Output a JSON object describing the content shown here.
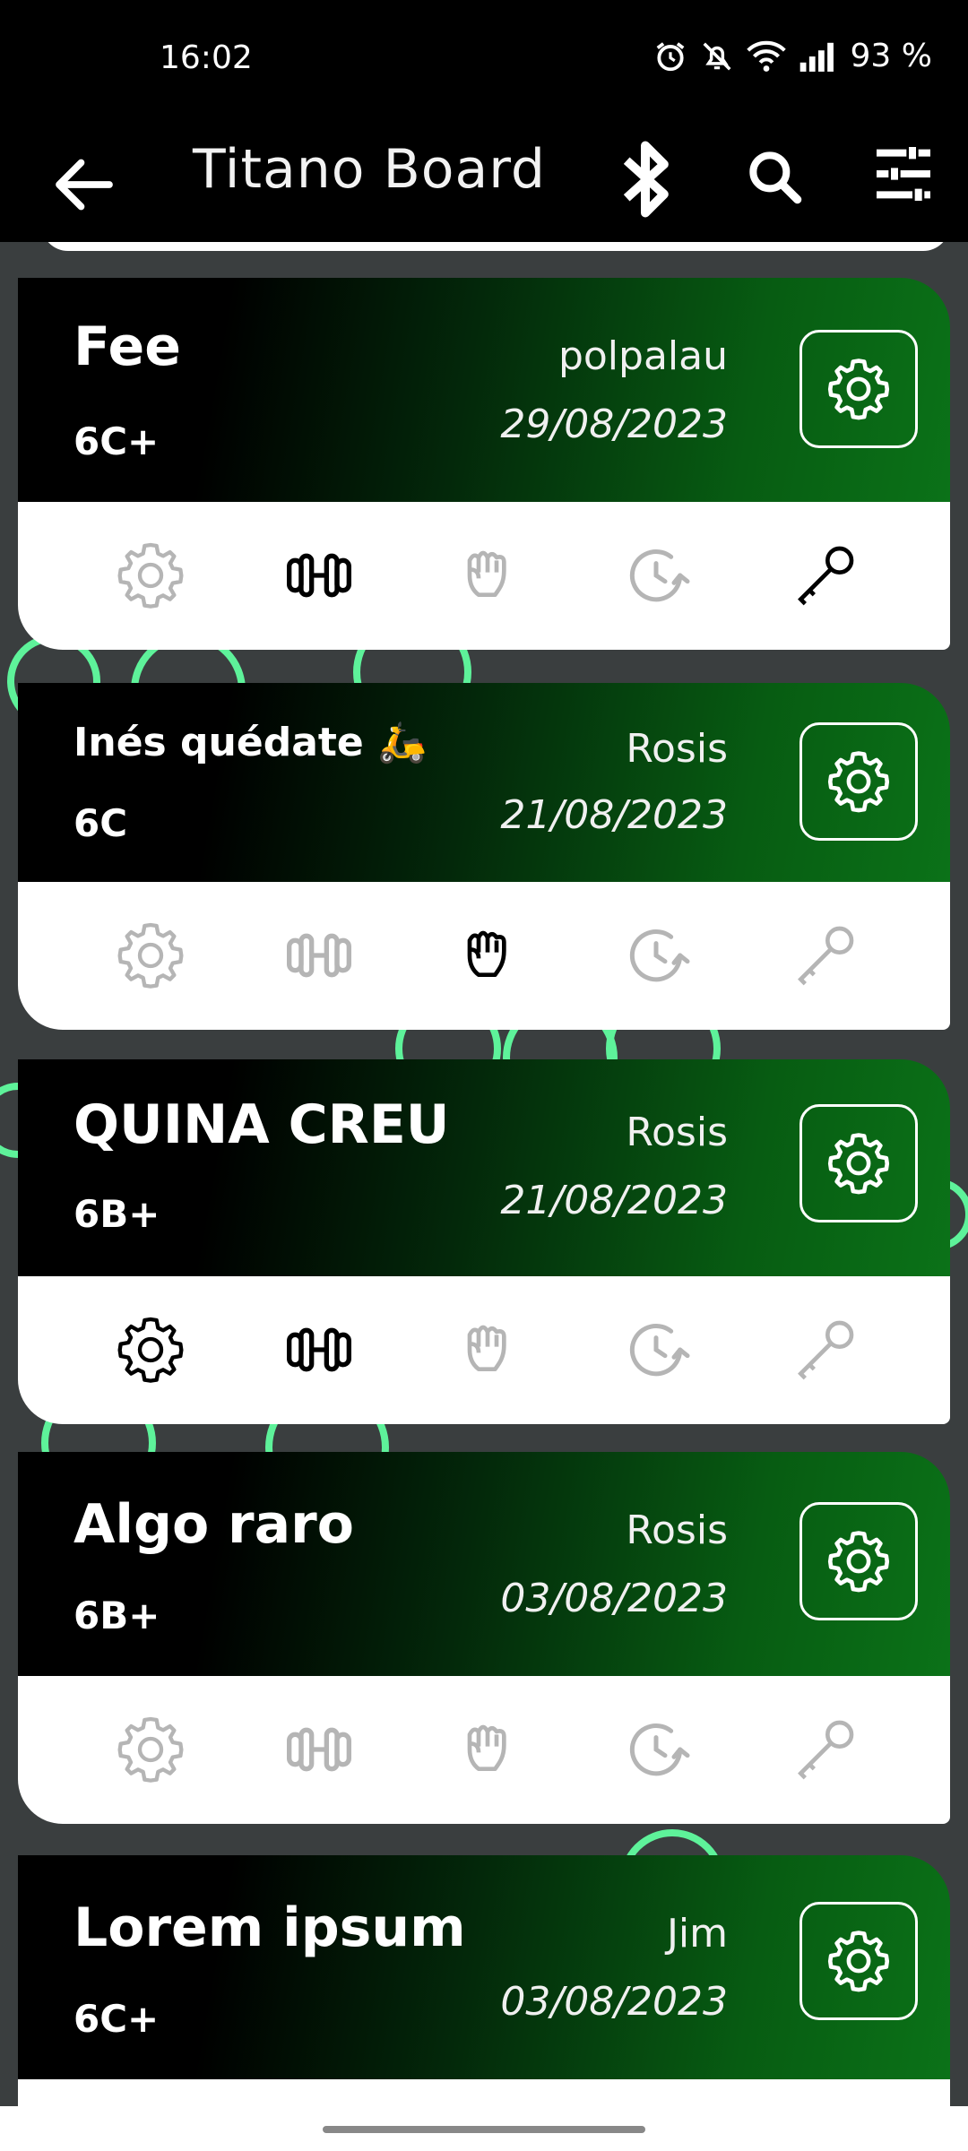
{
  "status": {
    "time": "16:02",
    "battery": "93 %"
  },
  "appbar": {
    "title": "Titano Board"
  },
  "colors": {
    "accent_green": "#0b7218",
    "deco_green": "#5ef29a",
    "icon_active": "#000000",
    "icon_inactive": "#b5b5b5"
  },
  "cards": [
    {
      "name": "Fee",
      "author": "polpalau",
      "date": "29/08/2023",
      "grade": "6C+",
      "icons": {
        "settings": false,
        "dumbbell": true,
        "hand": false,
        "timer": false,
        "key": true
      }
    },
    {
      "name": "Inés quédate 🛵",
      "author": "Rosis",
      "date": "21/08/2023",
      "grade": "6C",
      "icons": {
        "settings": false,
        "dumbbell": false,
        "hand": true,
        "timer": false,
        "key": false
      }
    },
    {
      "name": "QUINA CREU",
      "author": "Rosis",
      "date": "21/08/2023",
      "grade": "6B+",
      "icons": {
        "settings": true,
        "dumbbell": true,
        "hand": false,
        "timer": false,
        "key": false
      }
    },
    {
      "name": "Algo raro",
      "author": "Rosis",
      "date": "03/08/2023",
      "grade": "6B+",
      "icons": {
        "settings": false,
        "dumbbell": false,
        "hand": false,
        "timer": false,
        "key": false
      }
    },
    {
      "name": "Lorem ipsum",
      "author": "Jim",
      "date": "03/08/2023",
      "grade": "6C+",
      "icons": {
        "settings": false,
        "dumbbell": false,
        "hand": false,
        "timer": false,
        "key": false
      }
    }
  ]
}
